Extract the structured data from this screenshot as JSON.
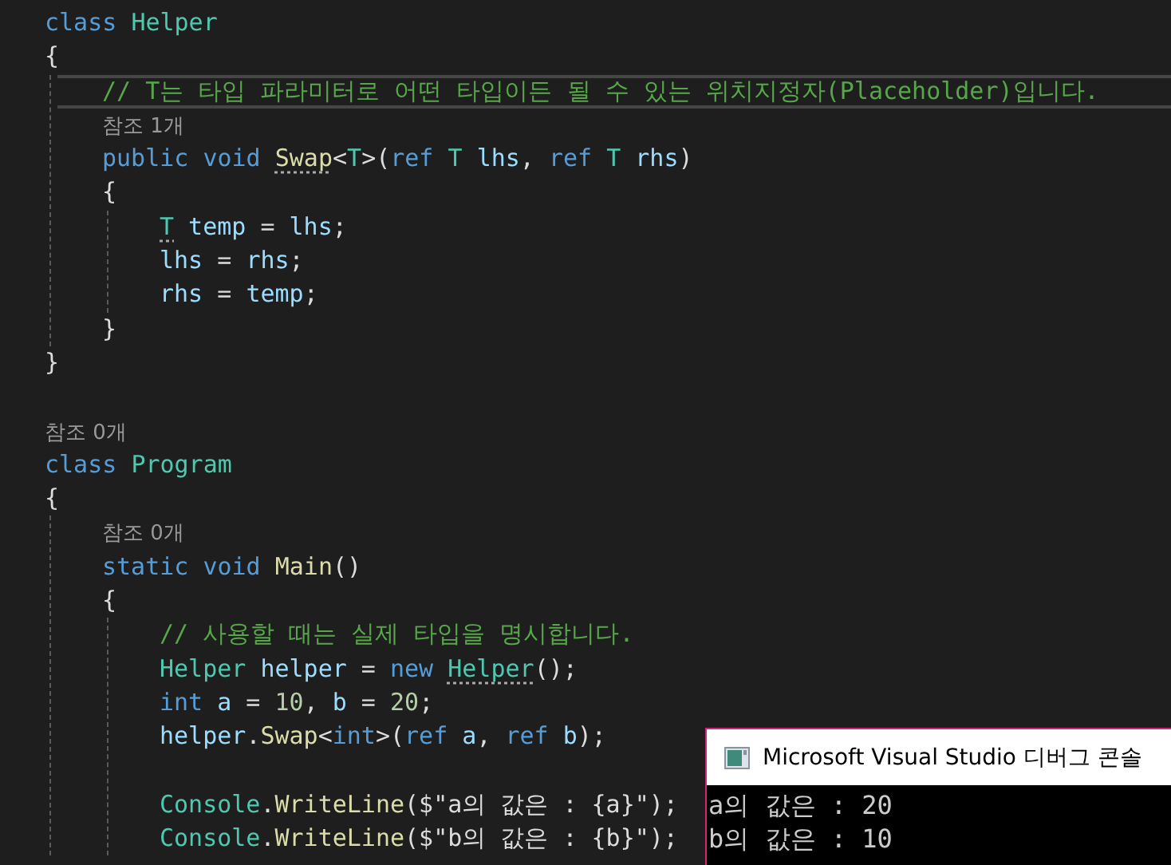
{
  "editor": {
    "lines": [
      {
        "kind": "code",
        "tokens": [
          {
            "text": "class ",
            "kind": "kw"
          },
          {
            "text": "Helper",
            "kind": "type"
          }
        ]
      },
      {
        "kind": "code",
        "tokens": [
          {
            "text": "{",
            "kind": "plain"
          }
        ],
        "children": [
          {
            "kind": "code",
            "current": true,
            "tokens": [
              {
                "text": "// T는 타입 파라미터로 어떤 타입이든 될 수 있는 위치지정자(Placeholder)입니다.",
                "kind": "comment"
              }
            ]
          },
          {
            "kind": "lens",
            "tokens": [
              {
                "text": "참조 1개",
                "kind": "lens"
              }
            ]
          },
          {
            "kind": "code",
            "tokens": [
              {
                "text": "public void ",
                "kind": "kw"
              },
              {
                "text": "Swap",
                "kind": "method",
                "hint": true
              },
              {
                "text": "<",
                "kind": "plain"
              },
              {
                "text": "T",
                "kind": "type"
              },
              {
                "text": ">(",
                "kind": "plain"
              },
              {
                "text": "ref ",
                "kind": "kw"
              },
              {
                "text": "T ",
                "kind": "type"
              },
              {
                "text": "lhs",
                "kind": "var"
              },
              {
                "text": ", ",
                "kind": "plain"
              },
              {
                "text": "ref ",
                "kind": "kw"
              },
              {
                "text": "T ",
                "kind": "type"
              },
              {
                "text": "rhs",
                "kind": "var"
              },
              {
                "text": ")",
                "kind": "plain"
              }
            ]
          },
          {
            "kind": "code",
            "tokens": [
              {
                "text": "{",
                "kind": "plain"
              }
            ],
            "children": [
              {
                "kind": "code",
                "tokens": [
                  {
                    "text": "T",
                    "kind": "type",
                    "hint": true
                  },
                  {
                    "text": " temp",
                    "kind": "var"
                  },
                  {
                    "text": " = ",
                    "kind": "plain"
                  },
                  {
                    "text": "lhs",
                    "kind": "var"
                  },
                  {
                    "text": ";",
                    "kind": "plain"
                  }
                ]
              },
              {
                "kind": "code",
                "tokens": [
                  {
                    "text": "lhs",
                    "kind": "var"
                  },
                  {
                    "text": " = ",
                    "kind": "plain"
                  },
                  {
                    "text": "rhs",
                    "kind": "var"
                  },
                  {
                    "text": ";",
                    "kind": "plain"
                  }
                ]
              },
              {
                "kind": "code",
                "tokens": [
                  {
                    "text": "rhs",
                    "kind": "var"
                  },
                  {
                    "text": " = ",
                    "kind": "plain"
                  },
                  {
                    "text": "temp",
                    "kind": "var"
                  },
                  {
                    "text": ";",
                    "kind": "plain"
                  }
                ]
              }
            ]
          },
          {
            "kind": "code",
            "tokens": [
              {
                "text": "}",
                "kind": "plain"
              }
            ]
          }
        ]
      },
      {
        "kind": "code",
        "tokens": [
          {
            "text": "}",
            "kind": "plain"
          }
        ]
      },
      {
        "kind": "blank"
      },
      {
        "kind": "lens",
        "tokens": [
          {
            "text": "참조 0개",
            "kind": "lens"
          }
        ]
      },
      {
        "kind": "code",
        "tokens": [
          {
            "text": "class ",
            "kind": "kw"
          },
          {
            "text": "Program",
            "kind": "type"
          }
        ]
      },
      {
        "kind": "code",
        "tokens": [
          {
            "text": "{",
            "kind": "plain"
          }
        ],
        "children": [
          {
            "kind": "lens",
            "tokens": [
              {
                "text": "참조 0개",
                "kind": "lens"
              }
            ]
          },
          {
            "kind": "code",
            "tokens": [
              {
                "text": "static void ",
                "kind": "kw"
              },
              {
                "text": "Main",
                "kind": "method"
              },
              {
                "text": "()",
                "kind": "plain"
              }
            ]
          },
          {
            "kind": "code",
            "tokens": [
              {
                "text": "{",
                "kind": "plain"
              }
            ],
            "children": [
              {
                "kind": "code",
                "tokens": [
                  {
                    "text": "// 사용할 때는 실제 타입을 명시합니다.",
                    "kind": "comment"
                  }
                ]
              },
              {
                "kind": "code",
                "tokens": [
                  {
                    "text": "Helper ",
                    "kind": "type"
                  },
                  {
                    "text": "helper",
                    "kind": "var"
                  },
                  {
                    "text": " = ",
                    "kind": "plain"
                  },
                  {
                    "text": "new ",
                    "kind": "kw"
                  },
                  {
                    "text": "Helper",
                    "kind": "type",
                    "hint": true
                  },
                  {
                    "text": "();",
                    "kind": "plain"
                  }
                ]
              },
              {
                "kind": "code",
                "tokens": [
                  {
                    "text": "int ",
                    "kind": "kw"
                  },
                  {
                    "text": "a",
                    "kind": "var"
                  },
                  {
                    "text": " = ",
                    "kind": "plain"
                  },
                  {
                    "text": "10",
                    "kind": "num"
                  },
                  {
                    "text": ", ",
                    "kind": "plain"
                  },
                  {
                    "text": "b",
                    "kind": "var"
                  },
                  {
                    "text": " = ",
                    "kind": "plain"
                  },
                  {
                    "text": "20",
                    "kind": "num"
                  },
                  {
                    "text": ";",
                    "kind": "plain"
                  }
                ]
              },
              {
                "kind": "code",
                "tokens": [
                  {
                    "text": "helper",
                    "kind": "var"
                  },
                  {
                    "text": ".",
                    "kind": "plain"
                  },
                  {
                    "text": "Swap",
                    "kind": "method"
                  },
                  {
                    "text": "<",
                    "kind": "plain"
                  },
                  {
                    "text": "int",
                    "kind": "kw"
                  },
                  {
                    "text": ">(",
                    "kind": "plain"
                  },
                  {
                    "text": "ref ",
                    "kind": "kw"
                  },
                  {
                    "text": "a",
                    "kind": "var"
                  },
                  {
                    "text": ", ",
                    "kind": "plain"
                  },
                  {
                    "text": "ref ",
                    "kind": "kw"
                  },
                  {
                    "text": "b",
                    "kind": "var"
                  },
                  {
                    "text": ");",
                    "kind": "plain"
                  }
                ]
              },
              {
                "kind": "blank"
              },
              {
                "kind": "code",
                "tokens": [
                  {
                    "text": "Console",
                    "kind": "type"
                  },
                  {
                    "text": ".",
                    "kind": "plain"
                  },
                  {
                    "text": "WriteLine",
                    "kind": "method"
                  },
                  {
                    "text": "($\"a의 값은 : {a}\");",
                    "kind": "plain"
                  }
                ]
              },
              {
                "kind": "code",
                "tokens": [
                  {
                    "text": "Console",
                    "kind": "type"
                  },
                  {
                    "text": ".",
                    "kind": "plain"
                  },
                  {
                    "text": "WriteLine",
                    "kind": "method"
                  },
                  {
                    "text": "($\"b의 값은 : {b}\");",
                    "kind": "plain"
                  }
                ]
              }
            ]
          }
        ]
      }
    ]
  },
  "console": {
    "title": "Microsoft Visual Studio 디버그 콘솔",
    "output": [
      "a의 값은 : 20",
      "b의 값은 : 10"
    ]
  }
}
